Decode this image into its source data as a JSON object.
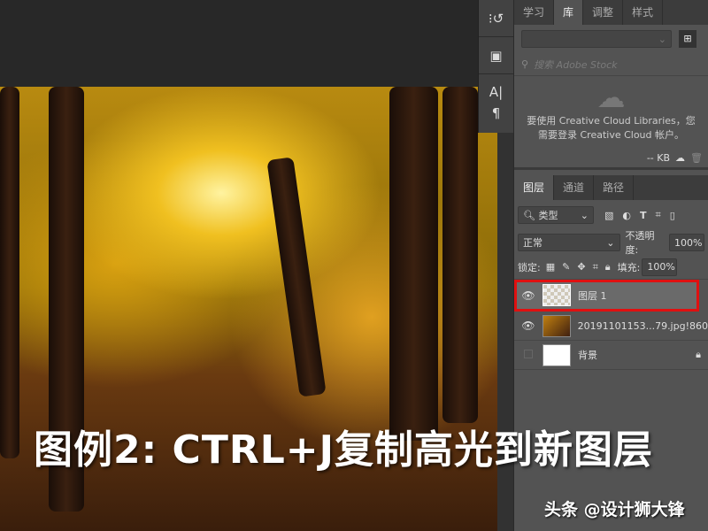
{
  "libraries_panel": {
    "tabs": [
      "学习",
      "库",
      "调整",
      "样式"
    ],
    "active_tab": "库",
    "search_placeholder": "搜索 Adobe Stock",
    "message_line1": "要使用 Creative Cloud Libraries，您",
    "message_line2": "需要登录 Creative Cloud 帐户。",
    "size": "-- KB"
  },
  "layers_panel": {
    "tabs": [
      "图层",
      "通道",
      "路径"
    ],
    "active_tab": "图层",
    "filter": "类型",
    "blend_mode": "正常",
    "opacity_label": "不透明度:",
    "opacity": "100%",
    "lock_label": "锁定:",
    "fill_label": "填充:",
    "fill": "100%",
    "layers": [
      {
        "name": "图层 1",
        "visible": true,
        "selected": true
      },
      {
        "name": "20191101153...79.jpg!860",
        "visible": true
      },
      {
        "name": "背景",
        "visible": false,
        "locked": true
      }
    ],
    "highlight_color": "#e01010"
  },
  "caption": "图例2:  CTRL+J复制高光到新图层",
  "watermark": "头条 @设计狮大锋"
}
